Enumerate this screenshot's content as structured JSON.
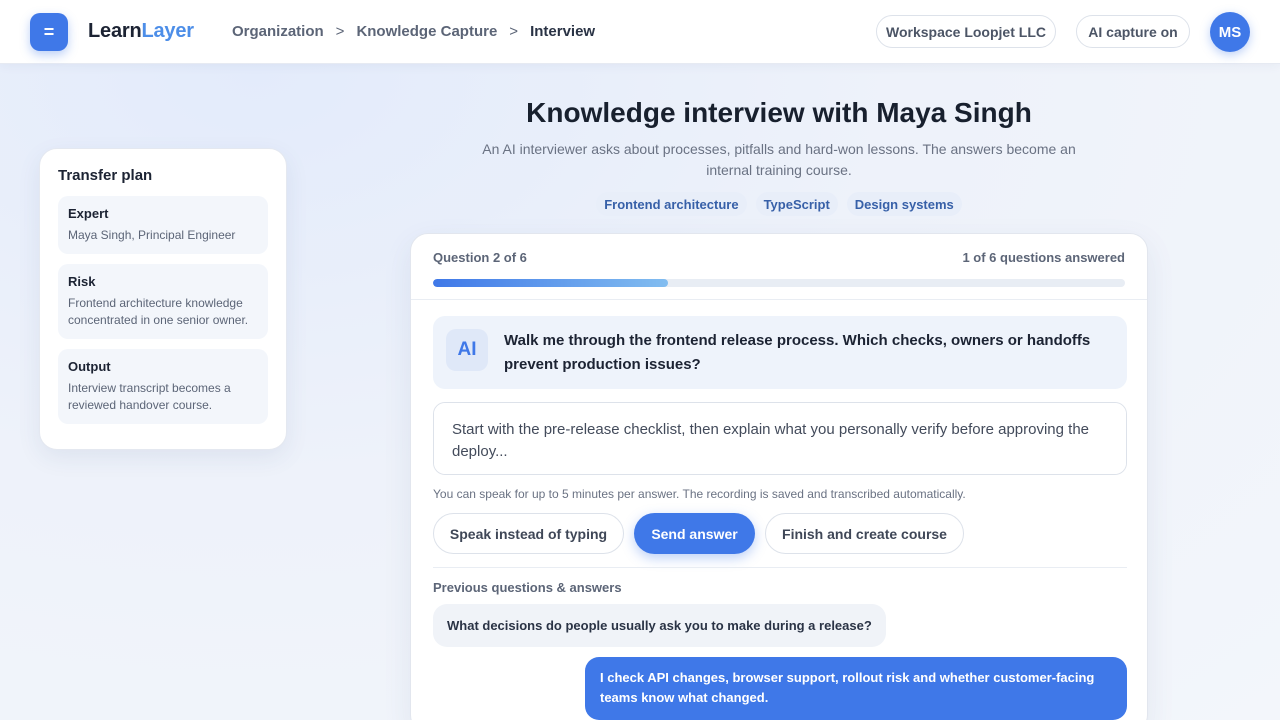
{
  "header": {
    "logo_glyph": "=",
    "brand_part1": "Learn",
    "brand_part2": "Layer",
    "breadcrumb": [
      "Organization",
      "Knowledge Capture",
      "Interview"
    ],
    "breadcrumb_sep": ">",
    "workspace": "Workspace Loopjet LLC",
    "capture_status": "AI capture on",
    "avatar_initials": "MS"
  },
  "sidebar": {
    "title": "Transfer plan",
    "items": [
      {
        "title": "Expert",
        "desc": "Maya Singh, Principal Engineer"
      },
      {
        "title": "Risk",
        "desc": "Frontend architecture knowledge concentrated in one senior owner."
      },
      {
        "title": "Output",
        "desc": "Interview transcript becomes a reviewed handover course."
      }
    ]
  },
  "main": {
    "title": "Knowledge interview with Maya Singh",
    "subtitle": "An AI interviewer asks about processes, pitfalls and hard-won lessons. The answers become an internal training course.",
    "tags": [
      "Frontend architecture",
      "TypeScript",
      "Design systems"
    ]
  },
  "interview": {
    "question_counter": "Question 2 of 6",
    "answered_counter": "1 of 6 questions answered",
    "progress_fraction": 0.34,
    "ai_badge": "AI",
    "current_question": "Walk me through the frontend release process. Which checks, owners or handoffs prevent production issues?",
    "answer_placeholder": "Start with the pre-release checklist, then explain what you personally verify before approving the deploy...",
    "hint": "You can speak for up to 5 minutes per answer. The recording is saved and transcribed automatically.",
    "speak_label": "Speak instead of typing",
    "send_label": "Send answer",
    "finish_label": "Finish and create course",
    "previous_label": "Previous questions & answers",
    "previous": [
      {
        "question": "What decisions do people usually ask you to make during a release?",
        "answer": "I check API changes, browser support, rollout risk and whether customer-facing teams know what changed."
      }
    ]
  },
  "colors": {
    "accent": "#3f78e8",
    "brand_highlight": "#4d8ee8",
    "tag_text": "#3760a8"
  }
}
